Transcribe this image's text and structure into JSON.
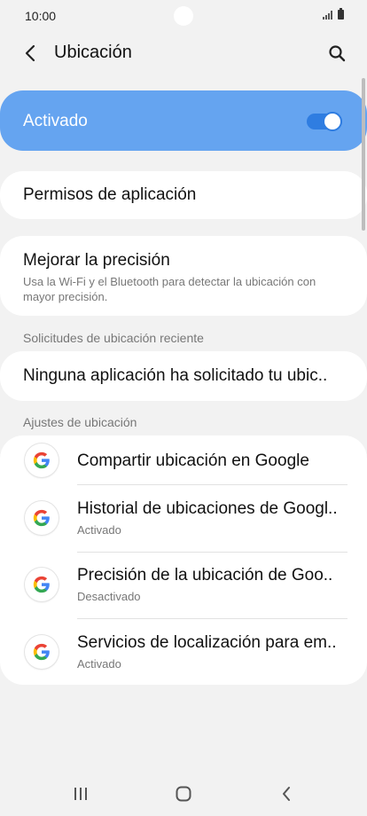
{
  "status_bar": {
    "time": "10:00"
  },
  "header": {
    "title": "Ubicación"
  },
  "master": {
    "label": "Activado",
    "enabled": true
  },
  "permissions": {
    "title": "Permisos de aplicación"
  },
  "accuracy": {
    "title": "Mejorar la precisión",
    "subtitle": "Usa la Wi-Fi y el Bluetooth para detectar la ubicación con mayor precisión."
  },
  "recent": {
    "header": "Solicitudes de ubicación reciente",
    "empty_label": "Ninguna aplicación ha solicitado tu ubic.."
  },
  "settings": {
    "header": "Ajustes de ubicación",
    "items": [
      {
        "title": "Compartir ubicación en Google",
        "subtitle": ""
      },
      {
        "title": "Historial de ubicaciones de Googl..",
        "subtitle": "Activado"
      },
      {
        "title": "Precisión de la ubicación de Goo..",
        "subtitle": "Desactivado"
      },
      {
        "title": "Servicios de localización para em..",
        "subtitle": "Activado"
      }
    ]
  },
  "colors": {
    "accent": "#65a4f0",
    "switch_on": "#2f7de1",
    "background": "#f2f2f2"
  },
  "icons": {
    "back": "chevron-left-icon",
    "search": "search-icon",
    "google": "google-icon",
    "nav_recents": "recent-apps-icon",
    "nav_home": "home-icon",
    "nav_back": "back-icon"
  }
}
